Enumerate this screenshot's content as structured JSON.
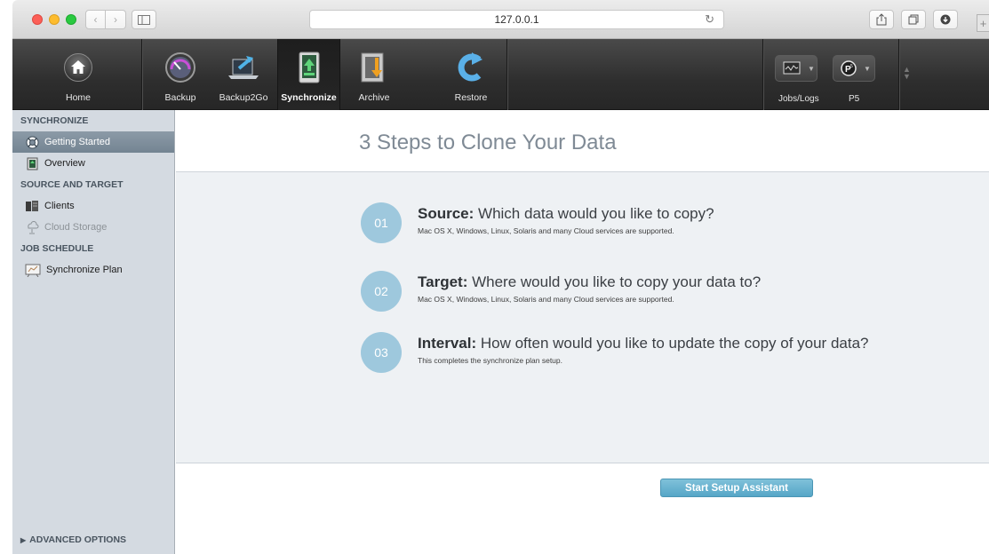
{
  "browser": {
    "address": "127.0.0.1"
  },
  "toolbar": {
    "items": [
      {
        "label": "Home",
        "icon": "home-icon"
      },
      {
        "label": "Backup",
        "icon": "backup-gauge-icon"
      },
      {
        "label": "Backup2Go",
        "icon": "laptop-sync-icon"
      },
      {
        "label": "Synchronize",
        "icon": "synchronize-icon"
      },
      {
        "label": "Archive",
        "icon": "archive-icon"
      },
      {
        "label": "Restore",
        "icon": "restore-arrow-icon"
      }
    ],
    "active": "Synchronize",
    "right": [
      {
        "label": "Jobs/Logs",
        "icon": "monitor-graph-icon"
      },
      {
        "label": "P5",
        "icon": "p5-logo-icon"
      }
    ]
  },
  "sidebar": {
    "sections": [
      {
        "title": "SYNCHRONIZE",
        "items": [
          {
            "label": "Getting Started",
            "icon": "lifebuoy-icon",
            "selected": true
          },
          {
            "label": "Overview",
            "icon": "overview-icon"
          }
        ]
      },
      {
        "title": "SOURCE AND TARGET",
        "items": [
          {
            "label": "Clients",
            "icon": "server-icon"
          },
          {
            "label": "Cloud Storage",
            "icon": "cloud-storage-icon",
            "disabled": true
          }
        ]
      },
      {
        "title": "JOB SCHEDULE",
        "items": [
          {
            "label": "Synchronize Plan",
            "icon": "plan-board-icon"
          }
        ]
      }
    ],
    "advanced": "ADVANCED OPTIONS"
  },
  "main": {
    "title": "3 Steps to Clone Your Data",
    "steps": [
      {
        "number": "01",
        "heading": "Source:",
        "question": "Which data would you like to copy?",
        "note": "Mac OS X, Windows, Linux, Solaris and many Cloud services are supported."
      },
      {
        "number": "02",
        "heading": "Target:",
        "question": "Where would you like to copy your data to?",
        "note": "Mac OS X, Windows, Linux, Solaris and many Cloud services are supported."
      },
      {
        "number": "03",
        "heading": "Interval:",
        "question": "How often would you like to update the copy of your data?",
        "note": "This completes the synchronize plan setup."
      }
    ],
    "start_button": "Start Setup Assistant"
  },
  "colors": {
    "accent": "#9ec8dd",
    "button": "#5aa9c9",
    "sidebar_bg": "#d4dae1",
    "selected": "#7e8d9b"
  }
}
